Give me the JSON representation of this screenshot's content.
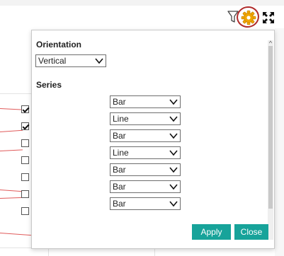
{
  "toolbar": {
    "icons": [
      "filter-icon",
      "gear-icon",
      "expand-icon"
    ]
  },
  "background": {
    "checkboxes": [
      true,
      true,
      false,
      false,
      false,
      false,
      false
    ]
  },
  "panel": {
    "orientation_label": "Orientation",
    "orientation_value": "Vertical",
    "series_label": "Series",
    "series": [
      "Bar",
      "Line",
      "Bar",
      "Line",
      "Bar",
      "Bar",
      "Bar"
    ],
    "apply_label": "Apply",
    "close_label": "Close"
  },
  "colors": {
    "accent": "#17a39a",
    "highlight_ring": "#b02a2a",
    "gear": "#f0a500",
    "chart_line": "#e05a5a"
  }
}
